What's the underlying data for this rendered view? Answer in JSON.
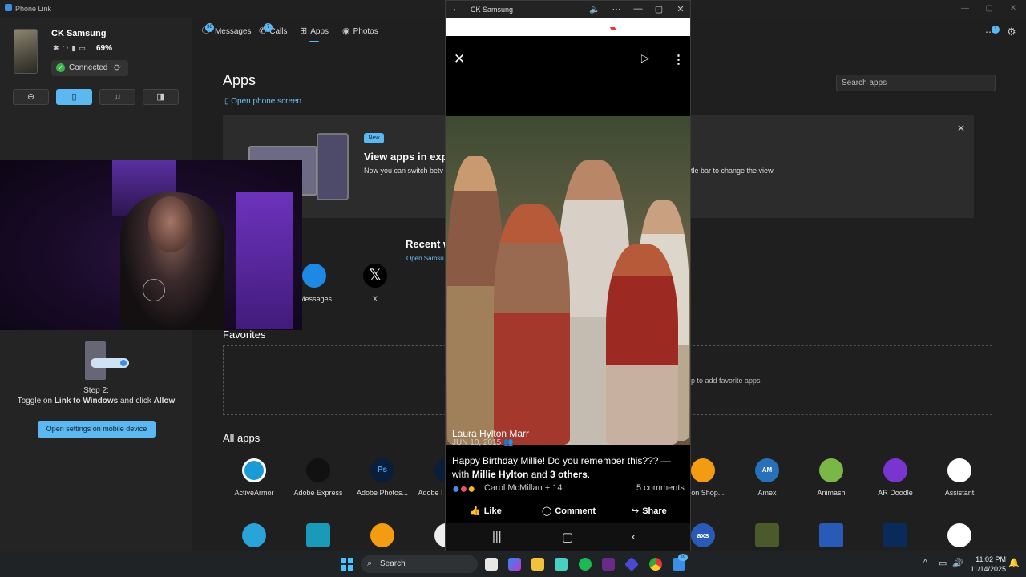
{
  "window": {
    "title": "Phone Link"
  },
  "device": {
    "name": "CK Samsung",
    "battery": "69%",
    "connection": "Connected"
  },
  "nav": {
    "tabs": [
      {
        "label": "Messages",
        "badge": "38"
      },
      {
        "label": "Calls",
        "badge": "7"
      },
      {
        "label": "Apps"
      },
      {
        "label": "Photos"
      }
    ],
    "notif_badge": "1"
  },
  "apps_page": {
    "heading": "Apps",
    "open_phone_screen": "Open phone screen",
    "search_placeholder": "Search apps",
    "banner": {
      "badge": "New",
      "title": "View apps in exp",
      "text_left": "Now you can switch betv",
      "text_right": "tle bar to change the view."
    },
    "recent": {
      "title": "Recent w",
      "subtitle": "Open Samsu",
      "apps": [
        "Messages",
        "X"
      ]
    },
    "favorites": {
      "title": "Favorites",
      "hint": "p to add favorite apps"
    },
    "all_apps": {
      "title": "All apps",
      "apps": [
        "ActiveArmor",
        "Adobe Express",
        "Adobe Photos...",
        "Adobe I",
        "azon Shop...",
        "Amex",
        "Animash",
        "AR Doodle",
        "Assistant"
      ]
    }
  },
  "setup": {
    "step_title": "Step 2:",
    "step_desc_pre": "Toggle on ",
    "step_desc_link": "Link to Windows",
    "step_desc_mid": " and click ",
    "step_desc_allow": "Allow",
    "button": "Open settings on mobile device"
  },
  "phone_window": {
    "title": "CK Samsung",
    "post": {
      "author": "Laura Hylton Marr",
      "date": "JUN 10, 2015",
      "body_pre": "Happy Birthday Millie!  Do you remember this??? — with ",
      "tag1": "Millie Hylton",
      "and": " and ",
      "tag2": "3 others",
      "end": ".",
      "reactors": "Carol McMillan + 14",
      "comments": "5 comments",
      "actions": [
        "Like",
        "Comment",
        "Share"
      ]
    }
  },
  "taskbar": {
    "search": "Search",
    "time": "11:02 PM",
    "date": "11/14/2025",
    "phonelink_badge": "20"
  },
  "colors": {
    "accent": "#5cb8f0",
    "connected": "#3cb54a",
    "background": "#1f1f1f"
  }
}
